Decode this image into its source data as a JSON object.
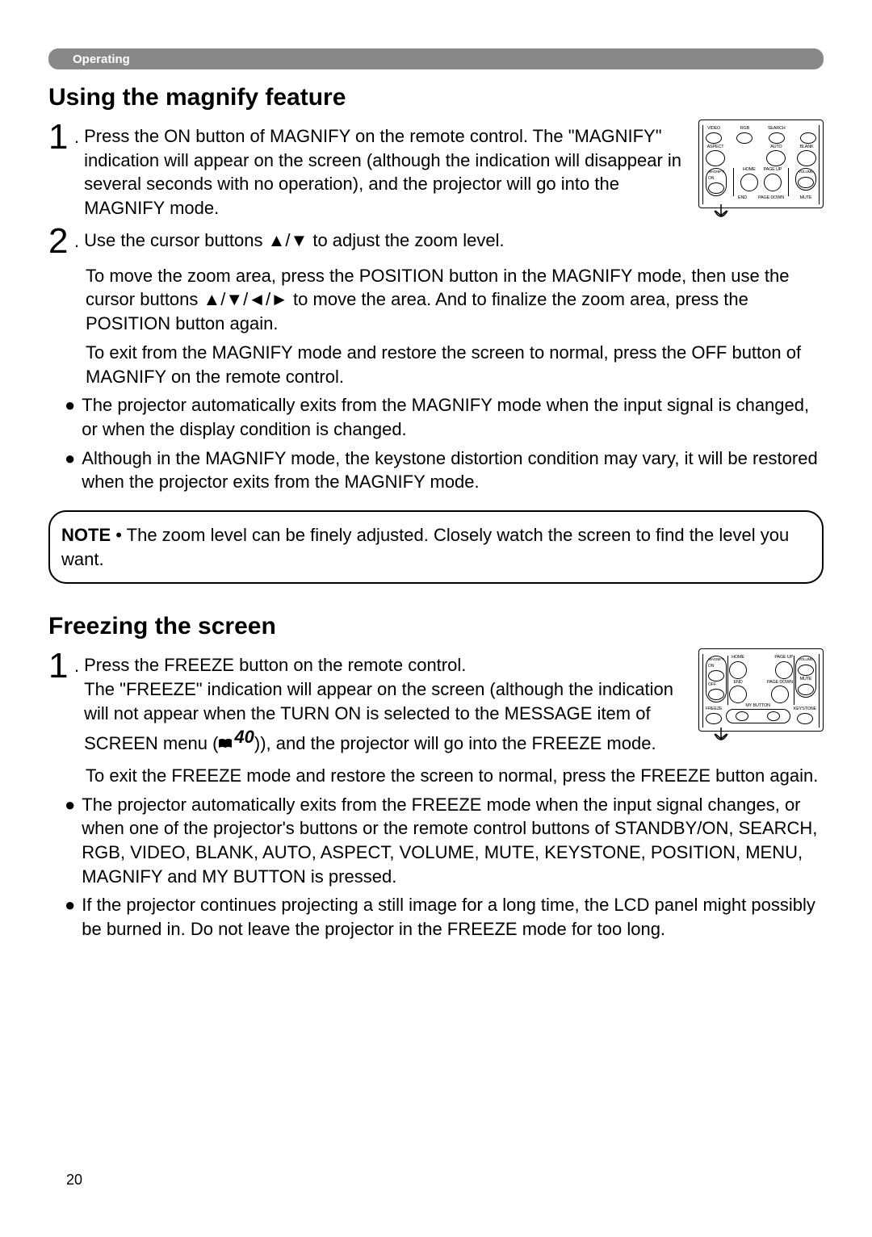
{
  "header": {
    "section": "Operating"
  },
  "page_number": "20",
  "magnify": {
    "title": "Using the magnify feature",
    "step1": "Press the ON button of MAGNIFY on the remote control. The \"MAGNIFY\" indication will appear on the screen (although the indication will disappear in several seconds with no operation), and the projector will go into the MAGNIFY mode.",
    "step2_a": "Use the cursor buttons ▲/▼ to adjust the zoom level.",
    "step2_b": "To move the zoom area, press the POSITION button in the MAGNIFY mode, then use the cursor buttons ▲/▼/◄/► to move the area. And to finalize the zoom area, press the POSITION button again.",
    "step2_c": "To exit from the MAGNIFY mode and restore the screen to normal, press the OFF button of MAGNIFY on the remote control.",
    "bullet1": "The projector automatically exits from the MAGNIFY mode when the input signal is changed, or when the display condition is changed.",
    "bullet2": "Although in the MAGNIFY mode, the keystone distortion condition may vary, it will be restored when the projector exits from the MAGNIFY mode.",
    "note_label": "NOTE",
    "note_text": " • The zoom level can be finely adjusted. Closely watch the screen to find the level you want."
  },
  "freeze": {
    "title": "Freezing the screen",
    "step1_a": "Press the FREEZE button on the remote control.",
    "step1_b_pre": "The \"FREEZE\" indication will appear on the screen (although the indication will not appear when the TURN ON is selected to the MESSAGE item of SCREEN menu (",
    "step1_b_ref": "40",
    "step1_b_post": ")), and the projector will go into the FREEZE mode.",
    "step1_c": "To exit the FREEZE mode and restore the screen to normal, press the FREEZE button again.",
    "bullet1": "The projector automatically exits from the FREEZE mode when the input signal changes, or when one of the projector's buttons or the remote control buttons of STANDBY/ON, SEARCH, RGB, VIDEO, BLANK, AUTO, ASPECT, VOLUME, MUTE, KEYSTONE, POSITION, MENU, MAGNIFY and MY BUTTON is pressed.",
    "bullet2": "If the projector continues projecting a still image for a long time, the LCD panel might possibly be burned in. Do not leave the projector in the FREEZE mode for too long."
  },
  "remote1": {
    "r1": [
      "VIDEO",
      "RGB",
      "SEARCH",
      ""
    ],
    "r2": [
      "ASPECT",
      "",
      "AUTO",
      "BLANK"
    ],
    "grp_l_top": "MAGNIFY",
    "grp_l_on": "ON",
    "grp_l_off": "",
    "mid": [
      "HOME",
      "PAGE UP"
    ],
    "grp_r_top": "VOLUME",
    "bot": [
      "END",
      "PAGE DOWN",
      "MUTE"
    ]
  },
  "remote2": {
    "grp_l_on": "ON",
    "grp_l_top": "MAGNIFY",
    "grp_l_off": "OFF",
    "mid_top": [
      "HOME",
      "PAGE UP"
    ],
    "grp_r_top": "VOLUME",
    "mid_bot": [
      "END",
      "PAGE DOWN",
      "MUTE"
    ],
    "bot_l": "FREEZE",
    "bot_m": "MY BUTTON",
    "bot_r": "KEYSTONE"
  }
}
